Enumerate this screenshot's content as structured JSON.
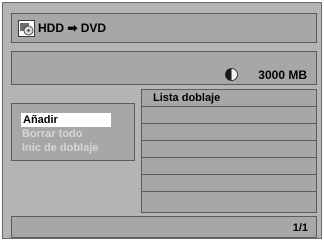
{
  "header": {
    "source": "HDD",
    "arrow": "➡",
    "target": "DVD",
    "icon": "hdd-to-dvd-icon"
  },
  "disk": {
    "capacity": "3000 MB",
    "icon": "disc-space-pie-icon"
  },
  "menu": {
    "items": [
      {
        "label": "Añadir",
        "state": "selected"
      },
      {
        "label": "Borrar todo",
        "state": "disabled"
      },
      {
        "label": "Inic de doblaje",
        "state": "disabled"
      }
    ]
  },
  "list": {
    "title": "Lista doblaje",
    "rows": [
      "",
      "",
      "",
      "",
      "",
      ""
    ]
  },
  "footer": {
    "page": "1/1"
  },
  "colors": {
    "panel": "#a7a7a7",
    "frame": "#b4b4b4",
    "border": "#5c5c5c",
    "highlight": "#ffffff",
    "disabled_text": "#d6d6d6"
  }
}
